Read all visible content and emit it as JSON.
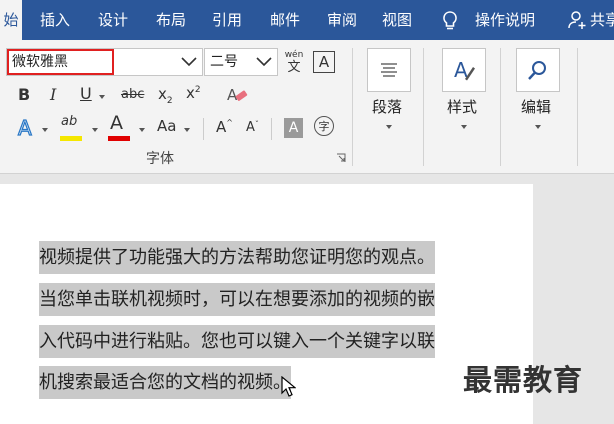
{
  "tabs": [
    {
      "label": "始",
      "active": true
    },
    {
      "label": "插入"
    },
    {
      "label": "设计"
    },
    {
      "label": "布局"
    },
    {
      "label": "引用"
    },
    {
      "label": "邮件"
    },
    {
      "label": "审阅"
    },
    {
      "label": "视图"
    }
  ],
  "tell_me": "操作说明",
  "share": "共享",
  "font": {
    "name": "微软雅黑",
    "size": "二号",
    "group_label": "字体",
    "phonetic_top": "wén",
    "phonetic_bottom": "文",
    "border_char": "A",
    "bold": "B",
    "italic": "I",
    "underline": "U",
    "strike": "abc",
    "subscript": "x",
    "superscript": "x",
    "subscript_mark": "2",
    "superscript_mark": "2",
    "highlight_text": "ab",
    "font_color_text": "A",
    "change_case": "Aa",
    "grow_font": "A",
    "shrink_font": "A",
    "shading_char": "A",
    "enclose_char": "字",
    "highlight_color": "#f5e700",
    "font_color": "#e00000"
  },
  "paragraph_label": "段落",
  "styles_label": "样式",
  "editing_label": "编辑",
  "document_lines": [
    "视频提供了功能强大的方法帮助您证明您的观点。",
    "当您单击联机视频时，可以在想要添加的视频的嵌",
    "入代码中进行粘贴。您也可以键入一个关键字以联",
    "机搜索最适合您的文档的视频。"
  ],
  "watermark": "最需教育",
  "accent_color": "#2b579a"
}
